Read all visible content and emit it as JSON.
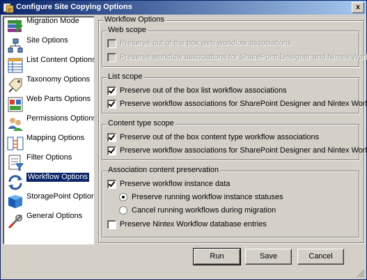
{
  "window": {
    "title": "Configure Site Copying Options",
    "close_symbol": "x"
  },
  "sidebar": {
    "items": [
      {
        "label": "Migration Mode",
        "icon": "migration-mode-icon",
        "selected": false
      },
      {
        "label": "Site Options",
        "icon": "site-options-icon",
        "selected": false
      },
      {
        "label": "List Content Options",
        "icon": "list-content-icon",
        "selected": false
      },
      {
        "label": "Taxonomy Options",
        "icon": "taxonomy-icon",
        "selected": false
      },
      {
        "label": "Web Parts Options",
        "icon": "web-parts-icon",
        "selected": false
      },
      {
        "label": "Permissions Options",
        "icon": "permissions-icon",
        "selected": false
      },
      {
        "label": "Mapping Options",
        "icon": "mapping-icon",
        "selected": false
      },
      {
        "label": "Filter Options",
        "icon": "filter-icon",
        "selected": false
      },
      {
        "label": "Workflow Options",
        "icon": "workflow-icon",
        "selected": true
      },
      {
        "label": "StoragePoint Options",
        "icon": "storagepoint-icon",
        "selected": false
      },
      {
        "label": "General Options",
        "icon": "general-options-icon",
        "selected": false
      }
    ]
  },
  "workflow": {
    "title": "Workflow Options",
    "web_scope": {
      "title": "Web scope",
      "opt1": {
        "label": "Preserve out of the box web workflow associations",
        "checked": false,
        "enabled": false
      },
      "opt2": {
        "label": "Preserve workflow associations for SharePoint Designer and Nintex Workflow",
        "checked": false,
        "enabled": false
      }
    },
    "list_scope": {
      "title": "List scope",
      "opt1": {
        "label": "Preserve out of the box list workflow associations",
        "checked": true
      },
      "opt2": {
        "label": "Preserve workflow associations for SharePoint Designer and Nintex Workflow",
        "checked": true
      }
    },
    "content_type_scope": {
      "title": "Content type scope",
      "opt1": {
        "label": "Preserve out of the box content type workflow associations",
        "checked": true
      },
      "opt2": {
        "label": "Preserve workflow associations for SharePoint Designer and Nintex Workflow",
        "checked": true
      }
    },
    "association": {
      "title": "Association content preservation",
      "instance_data": {
        "label": "Preserve workflow instance data",
        "checked": true
      },
      "radio_preserve": {
        "label": "Preserve running workflow instance statuses",
        "checked": true
      },
      "radio_cancel": {
        "label": "Cancel running workflows during migration",
        "checked": false
      },
      "nintex_db": {
        "label": "Preserve Nintex Workflow database entries",
        "checked": false
      }
    }
  },
  "buttons": {
    "run": "Run",
    "save": "Save",
    "cancel": "Cancel"
  },
  "colors": {
    "title_start": "#0a246a",
    "title_end": "#a6caf0",
    "selection": "#0a246a",
    "face": "#d4d0c8"
  }
}
